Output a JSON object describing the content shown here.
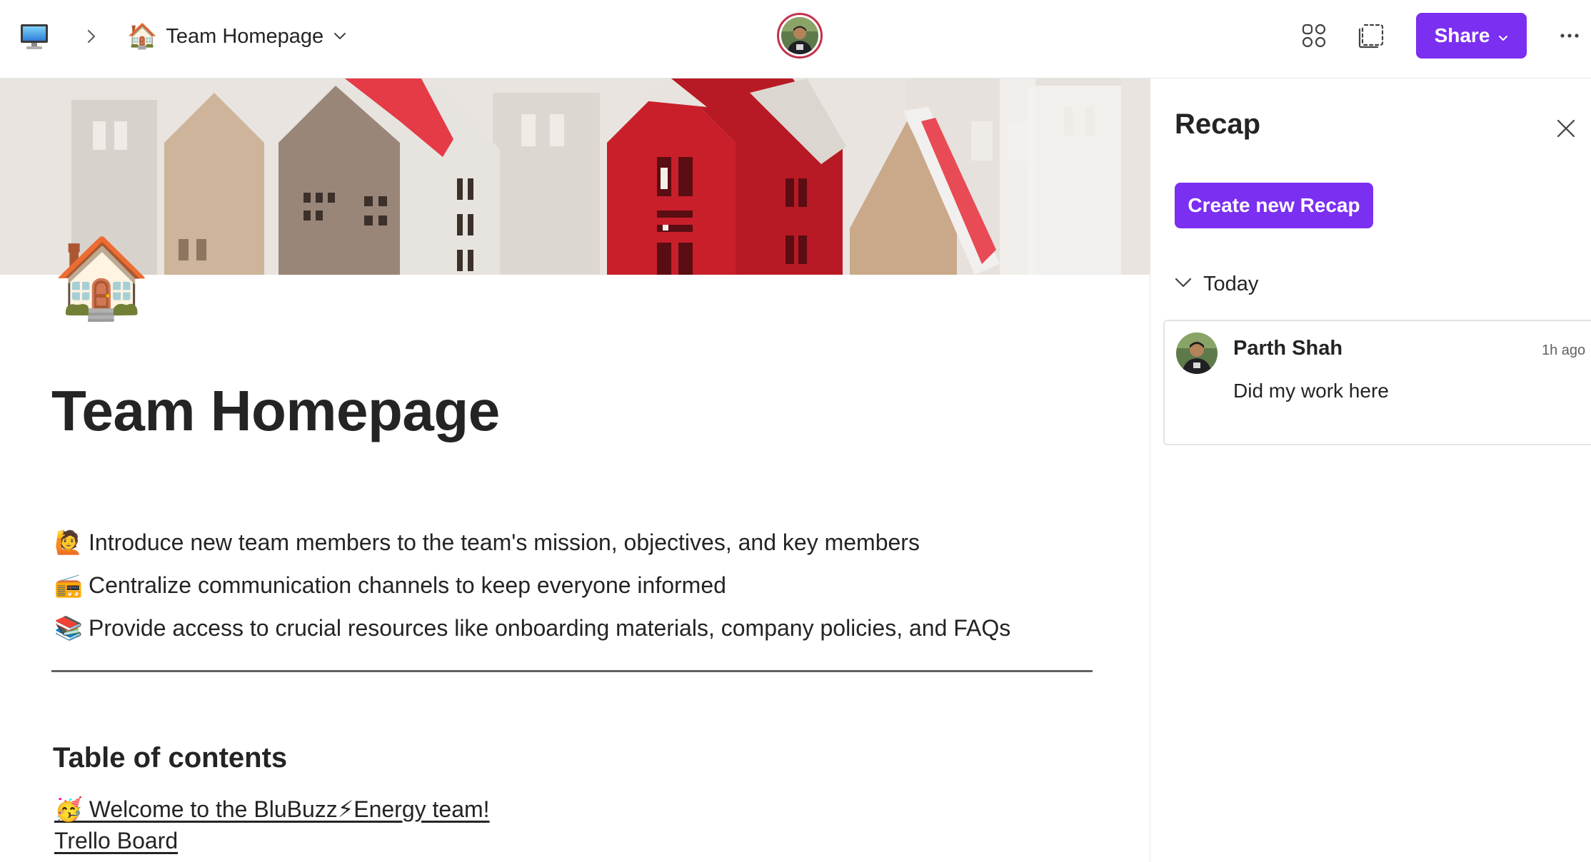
{
  "topbar": {
    "breadcrumb_page_emoji": "🏠",
    "breadcrumb_page_title": "Team Homepage",
    "share_label": "Share"
  },
  "page": {
    "emoji": "🏠",
    "title": "Team Homepage",
    "bullets": [
      {
        "emoji": "🙋",
        "text": "Introduce new team members to the team's mission, objectives, and key members"
      },
      {
        "emoji": "📻",
        "text": "Centralize communication channels to keep everyone informed"
      },
      {
        "emoji": "📚",
        "text": "Provide access to crucial resources like onboarding materials, company policies, and FAQs"
      }
    ],
    "toc_heading": "Table of contents",
    "toc_links": [
      "🥳 Welcome to the BluBuzz⚡Energy team!",
      "Trello Board"
    ]
  },
  "recap_panel": {
    "title": "Recap",
    "create_button": "Create new Recap",
    "group_label": "Today",
    "items": [
      {
        "author": "Parth Shah",
        "time": "1h ago",
        "message": "Did my work here"
      }
    ]
  },
  "colors": {
    "accent": "#7b2ff0",
    "avatar_ring": "#c4314b",
    "text": "#242424"
  },
  "icons": {
    "home_device": "monitor-icon",
    "apps": "apps-icon",
    "select": "select-area-icon",
    "more": "more-icon",
    "close": "close-icon"
  }
}
